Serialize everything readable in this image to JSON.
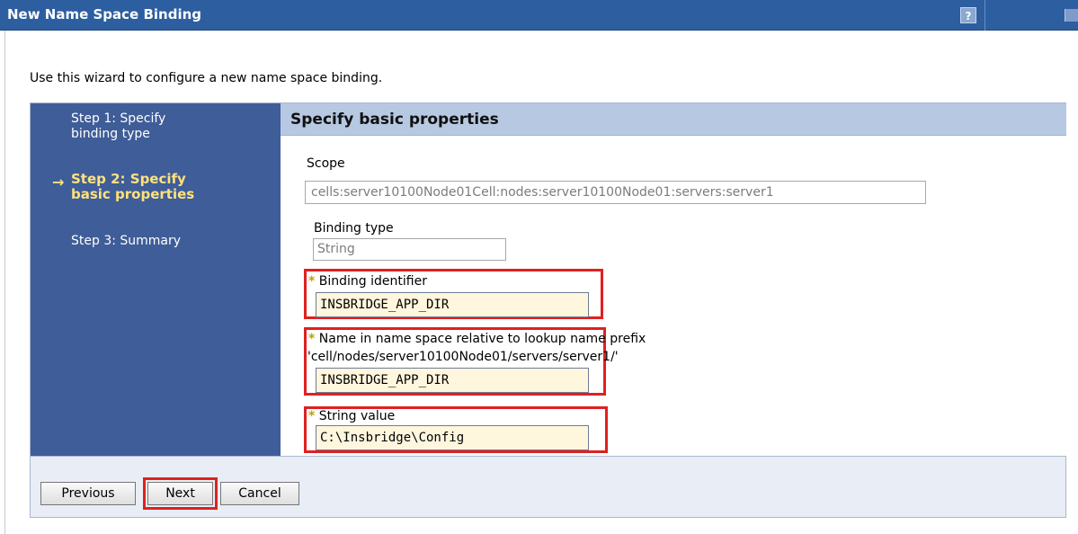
{
  "window": {
    "title": "New Name Space Binding",
    "help_icon_glyph": "?"
  },
  "intro": "Use this wizard to configure a new name space binding.",
  "steps": [
    {
      "label_line1": "Step 1: Specify",
      "label_line2": "binding type",
      "current": false
    },
    {
      "label_line1": "Step 2: Specify",
      "label_line2": "basic properties",
      "current": true
    },
    {
      "label_line1": "Step 3: Summary",
      "label_line2": "",
      "current": false
    }
  ],
  "current_step_arrow": "→",
  "panel": {
    "heading": "Specify basic properties",
    "scope_label": "Scope",
    "scope_value": "cells:server10100Node01Cell:nodes:server10100Node01:servers:server1",
    "binding_type_label": "Binding type",
    "binding_type_value": "String",
    "binding_identifier_label": "Binding identifier",
    "binding_identifier_value": "INSBRIDGE_APP_DIR",
    "name_in_ns_label": "Name in name space relative to lookup name prefix",
    "name_in_ns_prefix": "'cell/nodes/server10100Node01/servers/server1/'",
    "name_in_ns_value": "INSBRIDGE_APP_DIR",
    "string_value_label": "String value",
    "string_value_value": "C:\\Insbridge\\Config",
    "required_marker": "*"
  },
  "buttons": {
    "previous": "Previous",
    "next": "Next",
    "cancel": "Cancel"
  },
  "colors": {
    "title_bar": "#2d5ea0",
    "steps_bg": "#3f5d98",
    "current_step": "#ffe27a",
    "header_bg": "#b7c9e2",
    "input_bg": "#fff6de",
    "highlight": "#e02020"
  }
}
